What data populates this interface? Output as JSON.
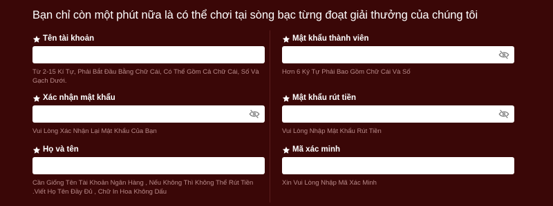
{
  "page": {
    "title": "Bạn chỉ còn một phút nữa là có thể chơi tại sòng bạc từng đoạt giải thưởng của chúng tôi"
  },
  "colors": {
    "background": "#3a0707",
    "hint_text": "#b98a8a",
    "input_bg": "#ffffff"
  },
  "form": {
    "username": {
      "label": "Tên tài khoản",
      "value": "",
      "hint": "Từ 2-15 Kí Tự, Phải Bắt Đầu Bằng Chữ Cái, Có Thể Gồm Cả Chữ Cái, Số Và Gạch Dưới."
    },
    "member_password": {
      "label": "Mật khẩu thành viên",
      "value": "",
      "hint": "Hơn 6 Ký Tự Phải Bao Gồm Chữ Cái Và Số",
      "icon": "eye-slash-icon"
    },
    "confirm_password": {
      "label": "Xác nhận mật khẩu",
      "value": "",
      "hint": "Vui Lòng Xác Nhận Lại Mật Khẩu Của Bạn",
      "icon": "eye-slash-icon"
    },
    "withdraw_password": {
      "label": "Mật khẩu rút tiền",
      "value": "",
      "hint": "Vui Lòng Nhập Mật Khẩu Rút Tiền",
      "icon": "eye-slash-icon"
    },
    "full_name": {
      "label": "Họ và tên",
      "value": "",
      "hint": "Cần Giống Tên Tài Khoản Ngân Hàng , Nếu Không Thì Không Thể Rút Tiền .Viết Họ Tên Đầy Đủ , Chữ In Hoa Không Dấu"
    },
    "verification_code": {
      "label": "Mã xác minh",
      "value": "",
      "hint": "Xin Vui Lòng Nhập Mã Xác Minh"
    }
  }
}
